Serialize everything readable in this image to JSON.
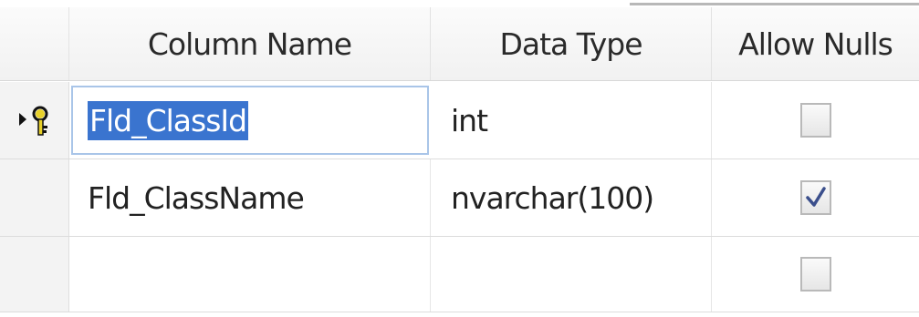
{
  "table_designer": {
    "headers": {
      "column_name": "Column Name",
      "data_type": "Data Type",
      "allow_nulls": "Allow Nulls"
    },
    "rows": [
      {
        "column_name": "Fld_ClassId",
        "data_type": "int",
        "allow_nulls": false,
        "primary_key": true,
        "current": true,
        "editing": true
      },
      {
        "column_name": "Fld_ClassName",
        "data_type": "nvarchar(100)",
        "allow_nulls": true,
        "primary_key": false
      },
      {
        "column_name": "",
        "data_type": "",
        "allow_nulls": false,
        "primary_key": false
      }
    ],
    "icons": {
      "row_indicator": "current-row-arrow-icon",
      "primary_key": "key-icon",
      "checkbox_checked": "check-icon"
    },
    "colors": {
      "selection": "#3a74cf",
      "edit_border": "#a9c5e8",
      "key_yellow": "#e8d12a"
    }
  }
}
